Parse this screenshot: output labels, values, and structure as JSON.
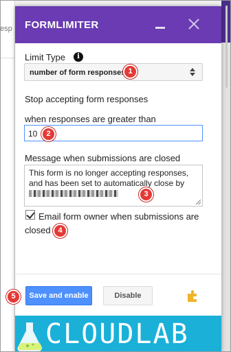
{
  "background": {
    "left_partial_text": "esp"
  },
  "header": {
    "title": "FORMLIMITER"
  },
  "limit_type": {
    "label": "Limit Type",
    "selected": "number of form responses"
  },
  "stop_section": {
    "heading": "Stop accepting form responses",
    "condition_label": "when responses are greater than",
    "value": "10"
  },
  "message": {
    "label": "Message when submissions are closed",
    "line1": "This form is no longer accepting responses,",
    "line2": "and has been set to automatically close by"
  },
  "email_option": {
    "line1": "Email form owner when submissions are",
    "line2": "closed",
    "checked": true
  },
  "badges": [
    "1",
    "2",
    "3",
    "4",
    "5"
  ],
  "buttons": {
    "save": "Save and enable",
    "disable": "Disable"
  },
  "banner": {
    "text": "CLOUDLAB"
  },
  "icons": {
    "info": "info-icon",
    "minimize": "minimize-icon",
    "close": "close-icon",
    "dropdown": "select-arrows-icon",
    "checkbox": "checkbox-checked-icon",
    "puzzle": "puzzle-icon",
    "flask": "flask-icon"
  },
  "colors": {
    "header": "#6a3bb3",
    "primary_button": "#4d90fe",
    "badge": "#e53935",
    "banner": "#1ab0d8",
    "puzzle": "#f0b429"
  }
}
